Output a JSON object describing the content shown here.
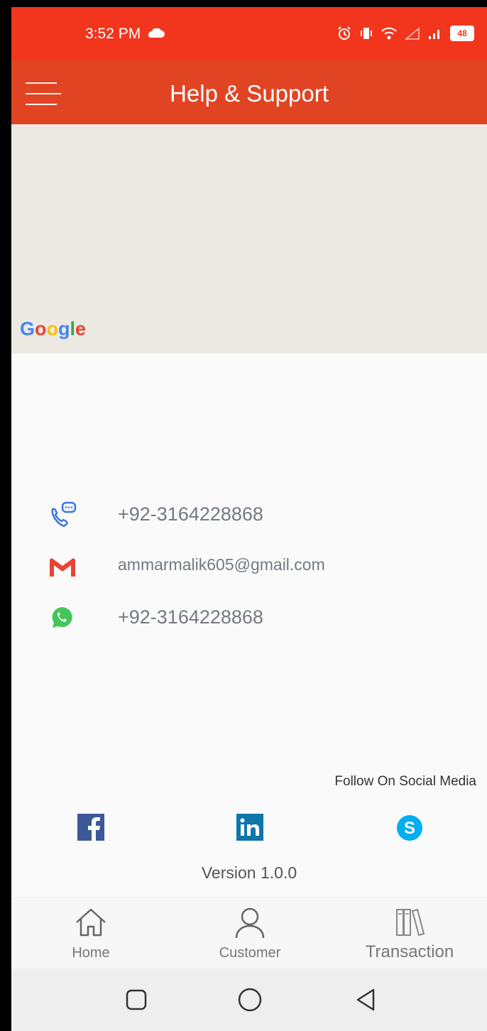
{
  "status": {
    "time": "3:52 PM",
    "battery": "48"
  },
  "appbar": {
    "title": "Help & Support",
    "menu_icon": "hamburger-menu-icon"
  },
  "map": {
    "attribution": "Google"
  },
  "contacts": [
    {
      "icon": "phone-call-icon",
      "text": "+92-3164228868"
    },
    {
      "icon": "gmail-icon",
      "text": "ammarmalik605@gmail.com"
    },
    {
      "icon": "whatsapp-icon",
      "text": "+92-3164228868"
    }
  ],
  "social": {
    "label": "Follow On Social Media",
    "items": [
      {
        "name": "facebook",
        "glyph": "f",
        "color": "#3b5998"
      },
      {
        "name": "linkedin",
        "glyph": "in",
        "color": "#0e76a8"
      },
      {
        "name": "skype",
        "glyph": "S",
        "color": "#00aff0"
      }
    ]
  },
  "version": "Version 1.0.0",
  "bottom_nav": [
    {
      "label": "Home",
      "icon": "home-icon"
    },
    {
      "label": "Customer",
      "icon": "person-icon"
    },
    {
      "label": "Transaction",
      "icon": "books-icon"
    }
  ],
  "colors": {
    "statusbar": "#f1361d",
    "appbar": "#e14423",
    "map": "#ece9e3"
  }
}
